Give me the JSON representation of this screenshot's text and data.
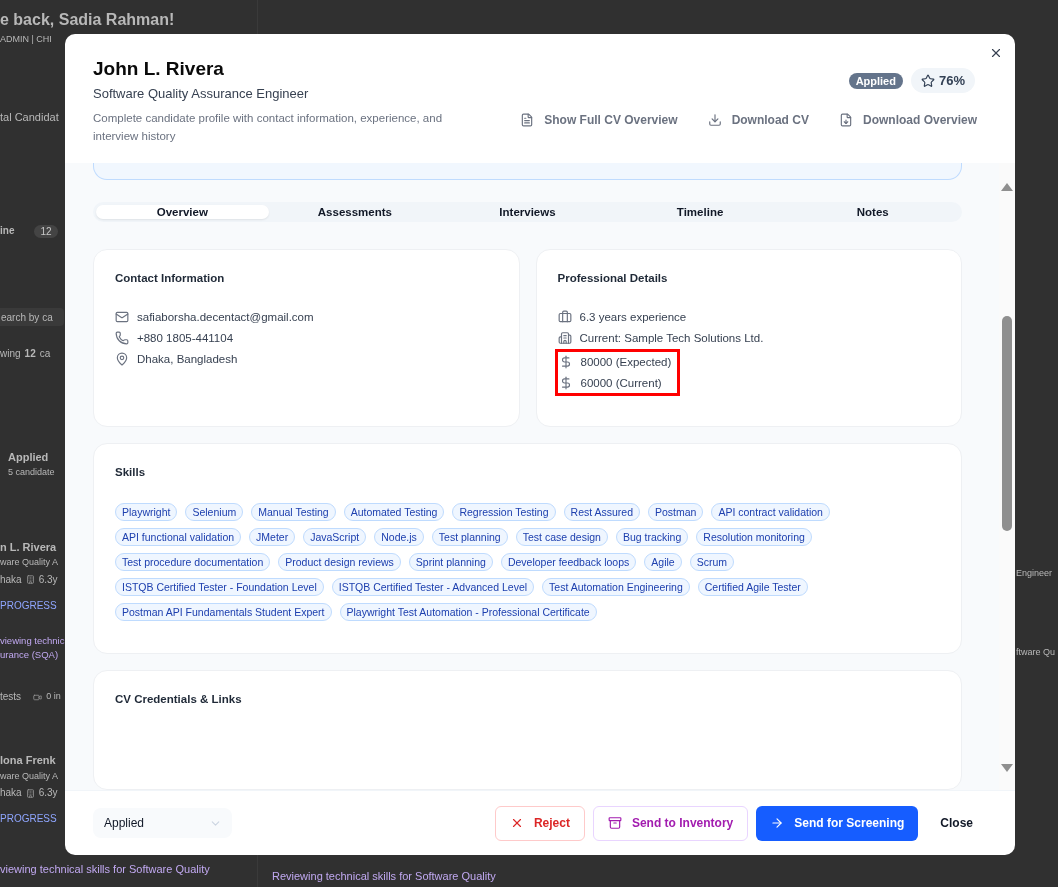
{
  "background": {
    "greeting": "e back, Sadia Rahman!",
    "role": "ADMIN | CHI",
    "stat_label": "tal Candidat",
    "pipeline_label": "ine",
    "pipeline_count": "12",
    "search_placeholder": "earch by ca",
    "showing": {
      "prefix": "wing",
      "count": "12",
      "suffix": "ca"
    },
    "stage": {
      "name": "Applied",
      "count": "5 candidate"
    },
    "cards": [
      {
        "name": "n L. Rivera",
        "title": "ware Quality A",
        "location": "haka",
        "experience": "6.3y",
        "status": "PROGRESS",
        "notes": [
          "viewing technic",
          "urance (SQA)"
        ],
        "tests": "tests",
        "interviews": "0 in"
      },
      {
        "name": "lona Frenk",
        "title": "ware Quality A",
        "location": "haka",
        "experience": "6.3y",
        "status": "PROGRESS",
        "notes": [
          "viewing technical skills for Software Quality"
        ]
      }
    ],
    "middle_note": "Reviewing technical skills for Software Quality",
    "right_texts": [
      "Engineer",
      "ftware Qu"
    ]
  },
  "modal": {
    "name": "John L. Rivera",
    "title": "Software Quality Assurance Engineer",
    "description": "Complete candidate profile with contact information, experience, and interview history",
    "status_badge": "Applied",
    "score": "76%",
    "actions": [
      {
        "kind": "document",
        "label": "Show Full CV Overview"
      },
      {
        "kind": "download",
        "label": "Download CV"
      },
      {
        "kind": "file-download",
        "label": "Download Overview"
      }
    ],
    "tabs": [
      {
        "label": "Overview",
        "selected": true
      },
      {
        "label": "Assessments",
        "selected": false
      },
      {
        "label": "Interviews",
        "selected": false
      },
      {
        "label": "Timeline",
        "selected": false
      },
      {
        "label": "Notes",
        "selected": false
      }
    ],
    "contact": {
      "title": "Contact Information",
      "items": [
        {
          "kind": "email",
          "text": "safiaborsha.decentact@gmail.com"
        },
        {
          "kind": "phone",
          "text": "+880 1805-441104"
        },
        {
          "kind": "location",
          "text": "Dhaka, Bangladesh"
        }
      ]
    },
    "professional": {
      "title": "Professional Details",
      "items": [
        {
          "kind": "experience",
          "text": "6.3 years experience",
          "highlighted": false
        },
        {
          "kind": "company",
          "text": "Current: Sample Tech Solutions Ltd.",
          "highlighted": false
        },
        {
          "kind": "salary",
          "text": "80000 (Expected)",
          "highlighted": true
        },
        {
          "kind": "salary",
          "text": "60000 (Current)",
          "highlighted": true
        }
      ]
    },
    "skills": {
      "title": "Skills",
      "tags": [
        "Playwright",
        "Selenium",
        "Manual Testing",
        "Automated Testing",
        "Regression Testing",
        "Rest Assured",
        "Postman",
        "API contract validation",
        "API functional validation",
        "JMeter",
        "JavaScript",
        "Node.js",
        "Test planning",
        "Test case design",
        "Bug tracking",
        "Resolution monitoring",
        "Test procedure documentation",
        "Product design reviews",
        "Sprint planning",
        "Developer feedback loops",
        "Agile",
        "Scrum",
        "ISTQB Certified Tester - Foundation Level",
        "ISTQB Certified Tester - Advanced Level",
        "Test Automation Engineering",
        "Certified Agile Tester",
        "Postman API Fundamentals Student Expert",
        "Playwright Test Automation - Professional Certificate"
      ]
    },
    "credentials": {
      "title": "CV Credentials & Links"
    },
    "footer": {
      "stage_select": "Applied",
      "buttons": [
        {
          "kind": "reject",
          "label": "Reject"
        },
        {
          "kind": "inventory",
          "label": "Send to Inventory"
        },
        {
          "kind": "primary",
          "label": "Send for Screening"
        },
        {
          "kind": "plain",
          "label": "Close"
        }
      ]
    }
  }
}
